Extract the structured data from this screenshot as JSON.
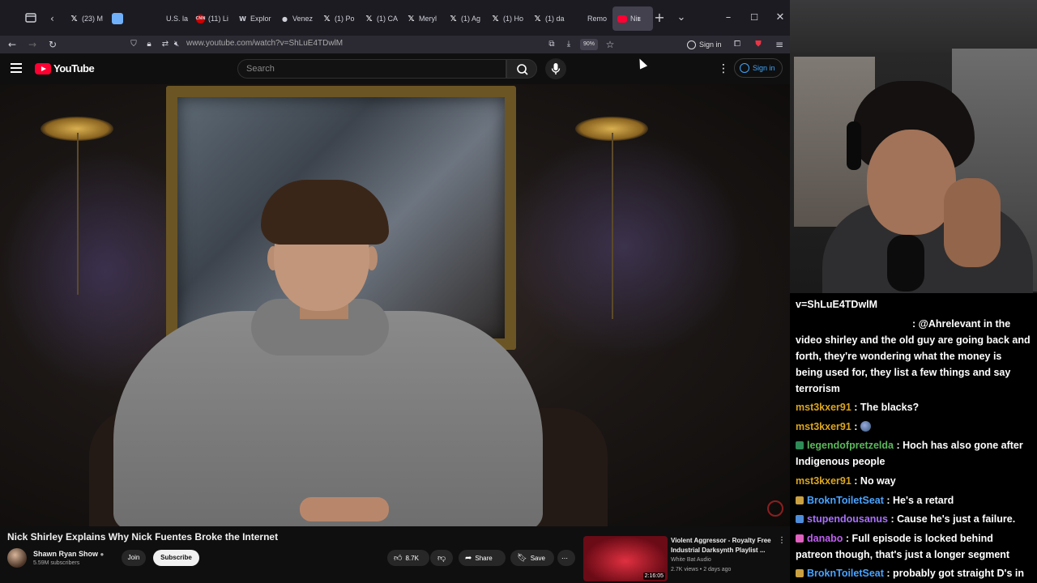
{
  "browser": {
    "tabs": [
      {
        "label": "(23) M",
        "favicon": "x-icon"
      },
      {
        "label": "",
        "favicon": "blue-square"
      },
      {
        "label": "U.S. la",
        "favicon": "none"
      },
      {
        "label": "(11) Li",
        "favicon": "cnn-icon"
      },
      {
        "label": "Explor",
        "favicon": "wp-icon"
      },
      {
        "label": "Venez",
        "favicon": "chat-icon"
      },
      {
        "label": "(1) Po",
        "favicon": "x-icon"
      },
      {
        "label": "(1) CA",
        "favicon": "x-icon"
      },
      {
        "label": "Meryl",
        "favicon": "x-icon"
      },
      {
        "label": "(1) Ag",
        "favicon": "x-icon"
      },
      {
        "label": "(1) Ho",
        "favicon": "x-icon"
      },
      {
        "label": "(1) da",
        "favicon": "x-icon"
      },
      {
        "label": "Remo",
        "favicon": "none"
      },
      {
        "label": "Nic",
        "favicon": "youtube-icon",
        "active": true
      }
    ],
    "url": "www.youtube.com/watch?v=ShLuE4TDwlM",
    "zoom": "90%",
    "signin_label": "Sign in"
  },
  "youtube": {
    "logo_text": "YouTube",
    "search_placeholder": "Search",
    "signin_label": "Sign in",
    "video_title": "Nick Shirley Explains Why Nick Fuentes Broke the Internet",
    "channel_name": "Shawn Ryan Show",
    "channel_subs": "5.59M subscribers",
    "join_label": "Join",
    "subscribe_label": "Subscribe",
    "likes": "8.7K",
    "share_label": "Share",
    "save_label": "Save",
    "recommended": {
      "title": "Violent Aggressor - Royalty Free Industrial Darksynth Playlist ...",
      "channel": "White Bat Audio",
      "meta": "2.7K views • 2 days ago",
      "duration": "2:16:05"
    }
  },
  "chat": {
    "url_fragment": "v=ShLuE4TDwlM",
    "messages": [
      {
        "user": "",
        "text": ": @Ahrelevant in the video shirley and the old guy are going back and forth, they're wondering what the money is being used for, they list a few things and say terrorism",
        "color": "#ffffff"
      },
      {
        "user": "mst3kxer91",
        "text": " : The blacks?",
        "color": "#daa520"
      },
      {
        "user": "mst3kxer91",
        "text": " : ",
        "color": "#daa520",
        "emote": true
      },
      {
        "user": "legendofpretzelda",
        "text": " : Hoch has also gone after Indigenous people",
        "color": "#5cb85c",
        "badge": "#2e8b57"
      },
      {
        "user": "mst3kxer91",
        "text": " : No way",
        "color": "#daa520"
      },
      {
        "user": "BroknToiletSeat",
        "text": " : He's a retard",
        "color": "#4aa3ff",
        "badge": "#caa040"
      },
      {
        "user": "stupendousanus",
        "text": " : Cause he's just a failure.",
        "color": "#a970ff",
        "badge": "#4c8cd9"
      },
      {
        "user": "danabo",
        "text": " : Full episode is locked behind patreon though, that's just a longer segment",
        "color": "#c060f0",
        "badge": "#e05fbf"
      },
      {
        "user": "BroknToiletSeat",
        "text": " : probably got straight D's in school",
        "color": "#4aa3ff",
        "badge": "#caa040"
      }
    ]
  },
  "colors": {
    "youtube_red": "#ff0033",
    "subscribe_bg": "#f1f1f1",
    "link_blue": "#3ea6ff"
  }
}
